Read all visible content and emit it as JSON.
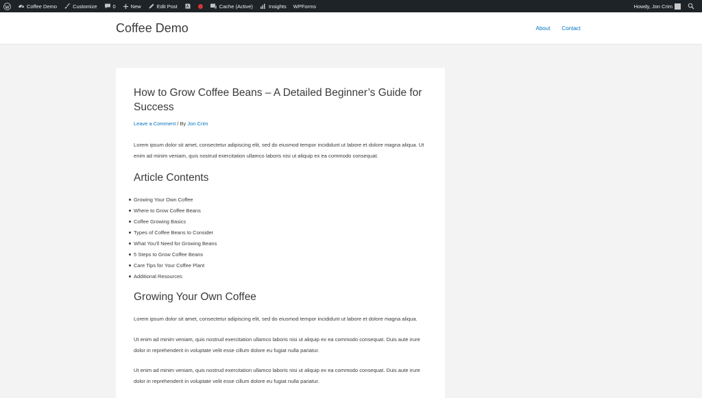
{
  "adminbar": {
    "site_name": "Coffee Demo",
    "customize": "Customize",
    "comments_count": "0",
    "new_label": "New",
    "edit_post": "Edit Post",
    "cache": "Cache (Active)",
    "insights": "Insights",
    "wpforms": "WPForms",
    "howdy": "Howdy, Jon Crim"
  },
  "header": {
    "site_title": "Coffee Demo",
    "nav": [
      "About",
      "Contact"
    ]
  },
  "post": {
    "title": "How to Grow Coffee Beans – A Detailed Beginner’s Guide for Success",
    "meta": {
      "comment_link": "Leave a Comment",
      "separator": " / By ",
      "author": "Jon Crim"
    },
    "intro": "Lorem ipsum dolor sit amet, consectetur adipiscing elit, sed do eiusmod tempor incididunt ut labore et dolore magna aliqua. Ut enim ad minim veniam, quis nostrud exercitation ullamco laboris nisi ut aliquip ex ea commodo consequat.",
    "toc_heading": "Article Contents",
    "toc": [
      "Growing Your Own Coffee",
      "Where to Grow Coffee Beans",
      "Coffee Growing Basics",
      "Types of Coffee Beans to Consider",
      "What You’ll Need for Growing Beans",
      "5 Steps to Grow Coffee Beans",
      "Care Tips for Your Coffee Plant",
      "Additional Resources"
    ],
    "section_heading": "Growing Your Own Coffee",
    "section_paragraphs": [
      "Lorem ipsum dolor sit amet, consectetur adipiscing elit, sed do eiusmod tempor incididunt ut labore et dolore magna aliqua.",
      "Ut enim ad minim veniam, quis nostrud exercitation ullamco laboris nisi ut aliquip ex ea commodo consequat. Duis aute irure dolor in reprehenderit in voluptate velit esse cillum dolore eu fugiat nulla pariatur.",
      "Ut enim ad minim veniam, quis nostrud exercitation ullamco laboris nisi ut aliquip ex ea commodo consequat. Duis aute irure dolor in reprehenderit in voluptate velit esse cillum dolore eu fugiat nulla pariatur."
    ]
  }
}
